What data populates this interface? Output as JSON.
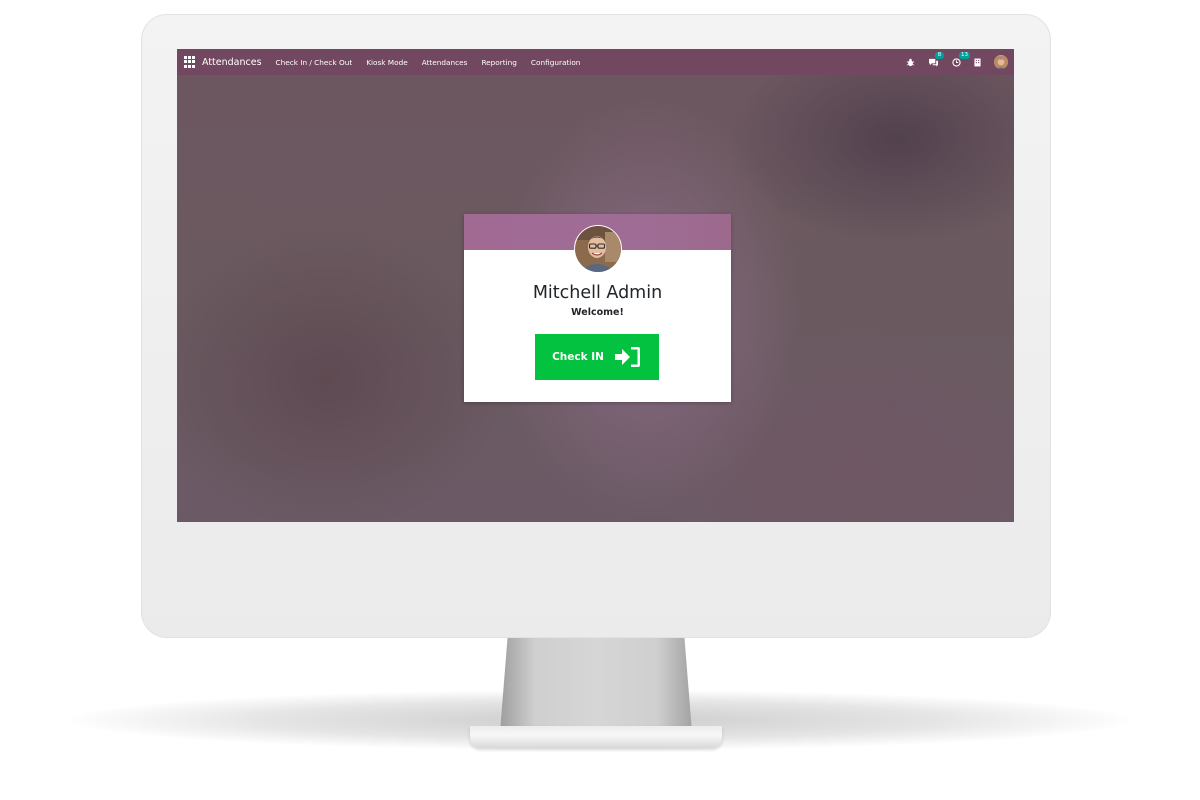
{
  "app": {
    "name": "Attendances"
  },
  "navbar": {
    "menu": [
      {
        "label": "Check In / Check Out"
      },
      {
        "label": "Kiosk Mode"
      },
      {
        "label": "Attendances"
      },
      {
        "label": "Reporting"
      },
      {
        "label": "Configuration"
      }
    ],
    "messages_count": "8",
    "activities_count": "13"
  },
  "card": {
    "employee_name": "Mitchell Admin",
    "greeting": "Welcome!",
    "button_label": "Check IN",
    "button_icon": "sign-in-icon"
  },
  "colors": {
    "navbar": "#71485f",
    "card_header": "#a16a93",
    "checkin_button": "#02c23f",
    "badge": "#00a09d"
  }
}
